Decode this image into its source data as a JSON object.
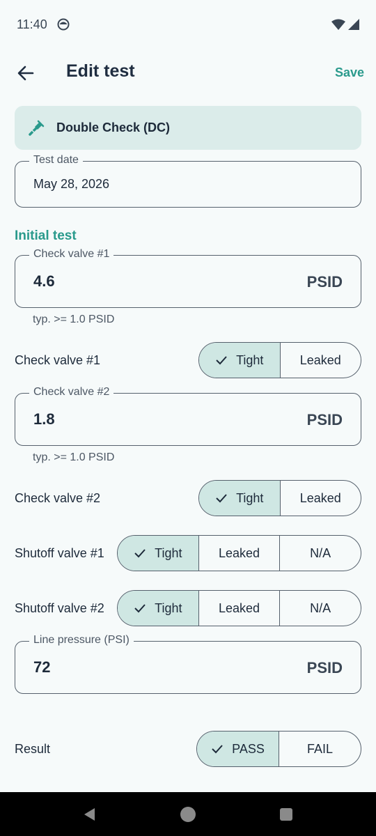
{
  "status": {
    "time": "11:40"
  },
  "header": {
    "title": "Edit test",
    "save_label": "Save"
  },
  "device": {
    "label": "Double Check (DC)"
  },
  "test_date": {
    "label": "Test date",
    "value": "May 28, 2026"
  },
  "section": {
    "title": "Initial test"
  },
  "cv1_field": {
    "label": "Check valve #1",
    "value": "4.6",
    "suffix": "PSID",
    "helper": "typ. >= 1.0 PSID"
  },
  "cv1_toggle": {
    "label": "Check valve #1",
    "options": [
      "Tight",
      "Leaked"
    ],
    "selected": "Tight"
  },
  "cv2_field": {
    "label": "Check valve #2",
    "value": "1.8",
    "suffix": "PSID",
    "helper": "typ. >= 1.0 PSID"
  },
  "cv2_toggle": {
    "label": "Check valve #2",
    "options": [
      "Tight",
      "Leaked"
    ],
    "selected": "Tight"
  },
  "sv1_toggle": {
    "label": "Shutoff valve #1",
    "options": [
      "Tight",
      "Leaked",
      "N/A"
    ],
    "selected": "Tight"
  },
  "sv2_toggle": {
    "label": "Shutoff valve #2",
    "options": [
      "Tight",
      "Leaked",
      "N/A"
    ],
    "selected": "Tight"
  },
  "line_pressure": {
    "label": "Line pressure (PSI)",
    "value": "72",
    "suffix": "PSID"
  },
  "result": {
    "label": "Result",
    "options": [
      "PASS",
      "FAIL"
    ],
    "selected": "PASS"
  },
  "colors": {
    "accent": "#2a9a8c",
    "selected_segment": "#cfe7e3",
    "card": "#dbecea"
  }
}
